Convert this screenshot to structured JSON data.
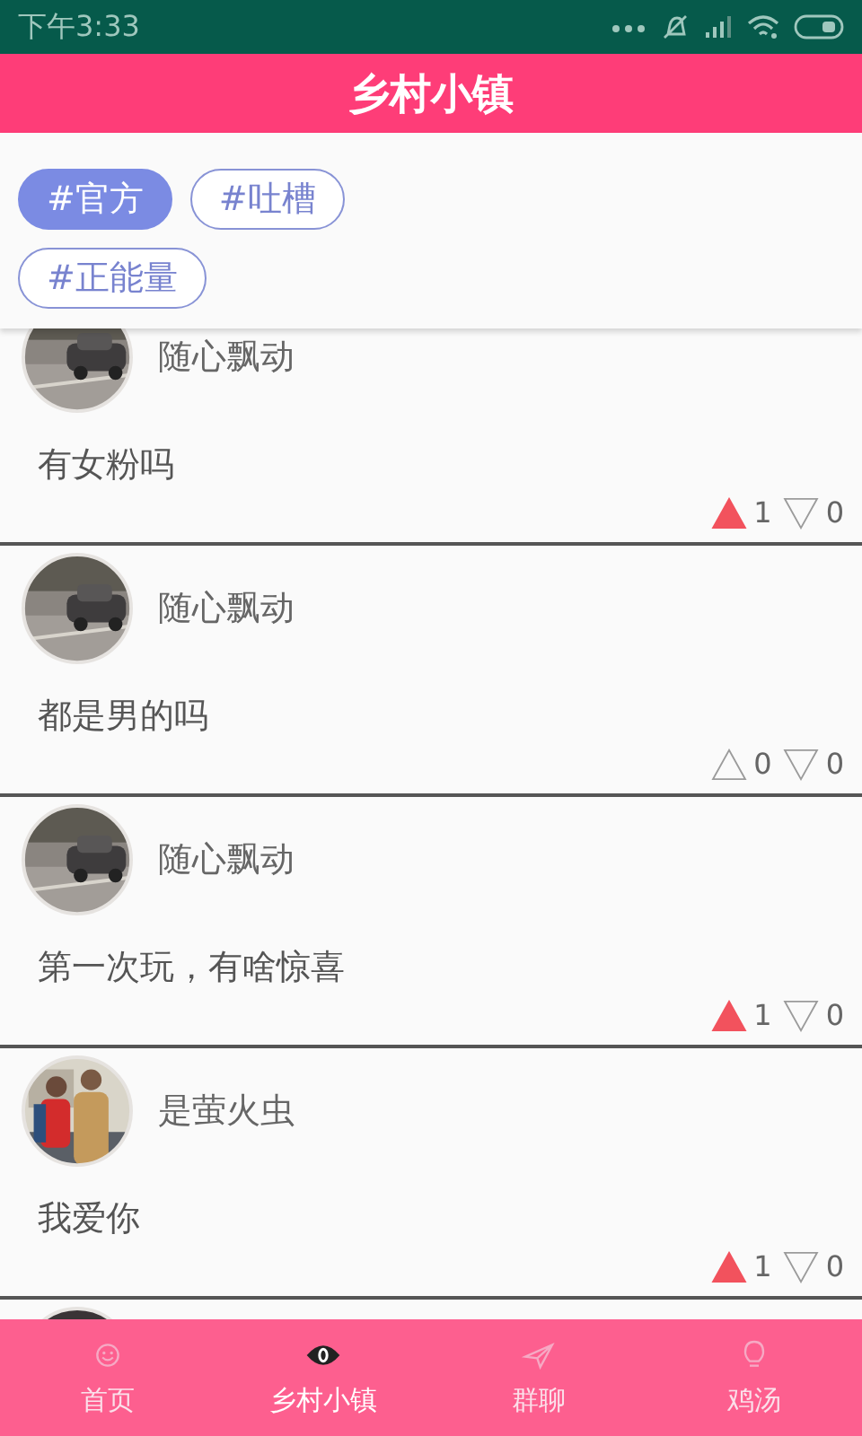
{
  "status_bar": {
    "time": "下午3:33"
  },
  "header": {
    "title": "乡村小镇"
  },
  "tags": [
    {
      "label": "#官方",
      "selected": true
    },
    {
      "label": "#吐槽",
      "selected": false
    },
    {
      "label": "#正能量",
      "selected": false
    }
  ],
  "posts": [
    {
      "avatar": {
        "kind": "picture"
      },
      "name": "随心飘动",
      "text": "有女粉吗",
      "upvoted": true,
      "up_count": "1",
      "downvoted": false,
      "down_count": "0"
    },
    {
      "avatar": {
        "kind": "picture"
      },
      "name": "随心飘动",
      "text": "都是男的吗",
      "upvoted": false,
      "up_count": "0",
      "downvoted": false,
      "down_count": "0"
    },
    {
      "avatar": {
        "kind": "picture"
      },
      "name": "随心飘动",
      "text": "第一次玩，有啥惊喜",
      "upvoted": true,
      "up_count": "1",
      "downvoted": false,
      "down_count": "0"
    },
    {
      "avatar": {
        "kind": "picture"
      },
      "name": "是萤火虫",
      "text": "我爱你",
      "upvoted": true,
      "up_count": "1",
      "downvoted": false,
      "down_count": "0"
    },
    {
      "avatar": {
        "kind": "picture"
      }
    }
  ],
  "bottom_nav": [
    {
      "label": "首页",
      "selected": false
    },
    {
      "label": "乡村小镇",
      "selected": true
    },
    {
      "label": "群聊",
      "selected": false
    },
    {
      "label": "鸡汤",
      "selected": false
    }
  ]
}
